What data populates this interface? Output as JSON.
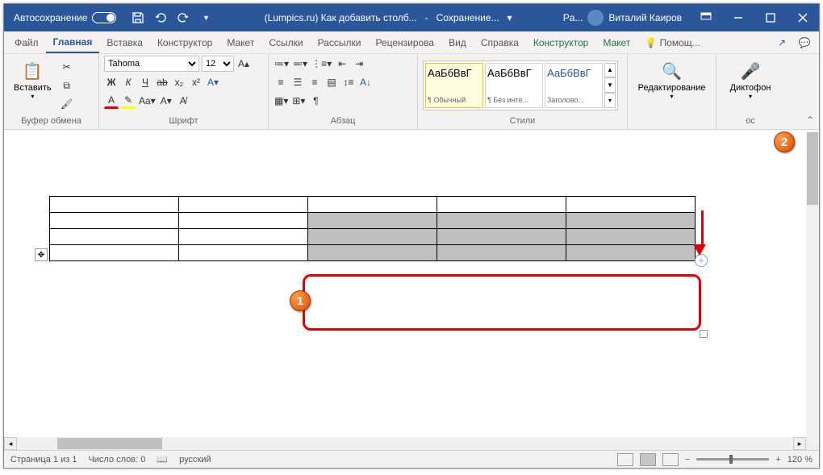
{
  "titlebar": {
    "autosave": "Автосохранение",
    "doc_title": "(Lumpics.ru) Как добавить столб...",
    "saving": "Сохранение...",
    "app_short": "Pa...",
    "user": "Виталий Каиров"
  },
  "tabs": {
    "file": "Файл",
    "home": "Главная",
    "insert": "Вставка",
    "design": "Конструктор",
    "layout": "Макет",
    "references": "Ссылки",
    "mailings": "Рассылки",
    "review": "Рецензирова",
    "view": "Вид",
    "help": "Справка",
    "tbl_design": "Конструктор",
    "tbl_layout": "Макет",
    "tell": "Помощ..."
  },
  "ribbon": {
    "paste": "Вставить",
    "clipboard": "Буфер обмена",
    "font_name": "Tahoma",
    "font_size": "12",
    "font_group": "Шрифт",
    "para_group": "Абзац",
    "styles_group": "Стили",
    "editing": "Редактирование",
    "dictate": "Диктофон",
    "voice_group": "ос",
    "styles": [
      {
        "preview": "АаБбВвГ",
        "name": "¶ Обычный"
      },
      {
        "preview": "АаБбВвГ",
        "name": "¶ Без инте..."
      },
      {
        "preview": "АаБбВвГ",
        "name": "Заголово..."
      }
    ]
  },
  "status": {
    "page": "Страница 1 из 1",
    "words": "Число слов: 0",
    "lang": "русский",
    "zoom": "120 %"
  },
  "callouts": {
    "one": "1",
    "two": "2"
  }
}
